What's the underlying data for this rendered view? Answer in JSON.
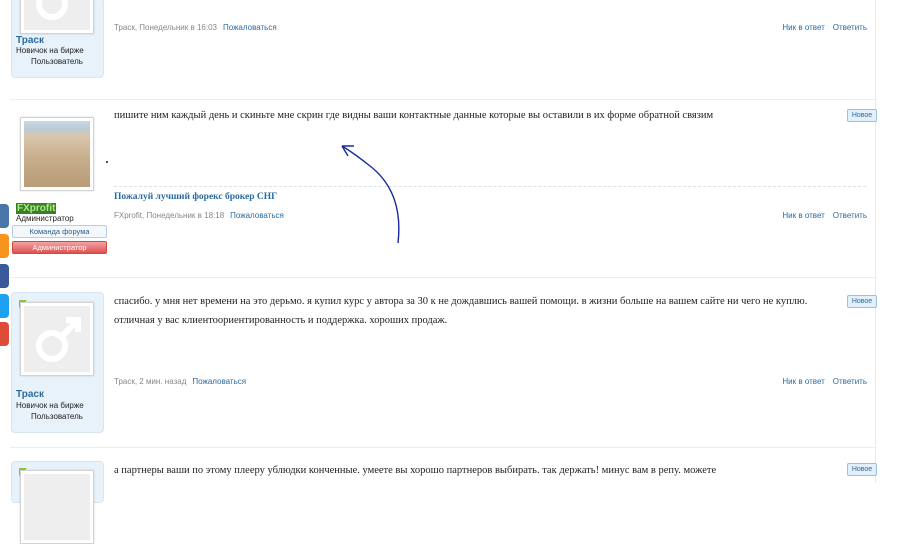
{
  "posts": [
    {
      "user": {
        "name": "Траск",
        "title": "Новичок на бирже",
        "badge": "Пользователь"
      },
      "meta": {
        "author": "Траск",
        "time": ", Понедельник в 16:03",
        "report": "Пожаловаться"
      },
      "actions": {
        "quote": "Ник в ответ",
        "reply": "Ответить"
      }
    },
    {
      "user": {
        "name": "FXprofit",
        "title": "Администратор",
        "badge1": "Команда форума",
        "badge2": "Администратор"
      },
      "message": "пишите ним каждый день и скиньте мне скрин где видны ваши контактные данные которые вы оставили в их форме обратной связим",
      "new_tag": "Новое",
      "signature": "Пожалуй лучший форекс брокер СНГ",
      "meta": {
        "author": "FXprofit",
        "time": ", Понедельник в 18:18",
        "report": "Пожаловаться"
      },
      "actions": {
        "quote": "Ник в ответ",
        "reply": "Ответить"
      }
    },
    {
      "user": {
        "name": "Траск",
        "title": "Новичок на бирже",
        "badge": "Пользователь"
      },
      "message": "спасибо. у мня нет времени на это дерьмо. я купил курс у автора за 30 к не дождавшись вашей помощи. в жизни больше на вашем сайте ни чего не куплю. отличная у вас клиентоориентированность и поддержка. хороших продаж.",
      "new_tag": "Новое",
      "meta": {
        "author": "Траск",
        "time": ", 2 мин. назад",
        "report": "Пожаловаться"
      },
      "actions": {
        "quote": "Ник в ответ",
        "reply": "Ответить"
      }
    },
    {
      "message": "а партнеры ваши по этому плееру ублюдки конченные. умеете вы хорошо партнеров выбирать. так держать! минус вам в репу. можете",
      "new_tag": "Новое"
    }
  ],
  "share_colors": [
    "#4a76a8",
    "#f7931e",
    "#3b5998",
    "#1da1f2",
    "#dd4b39"
  ]
}
